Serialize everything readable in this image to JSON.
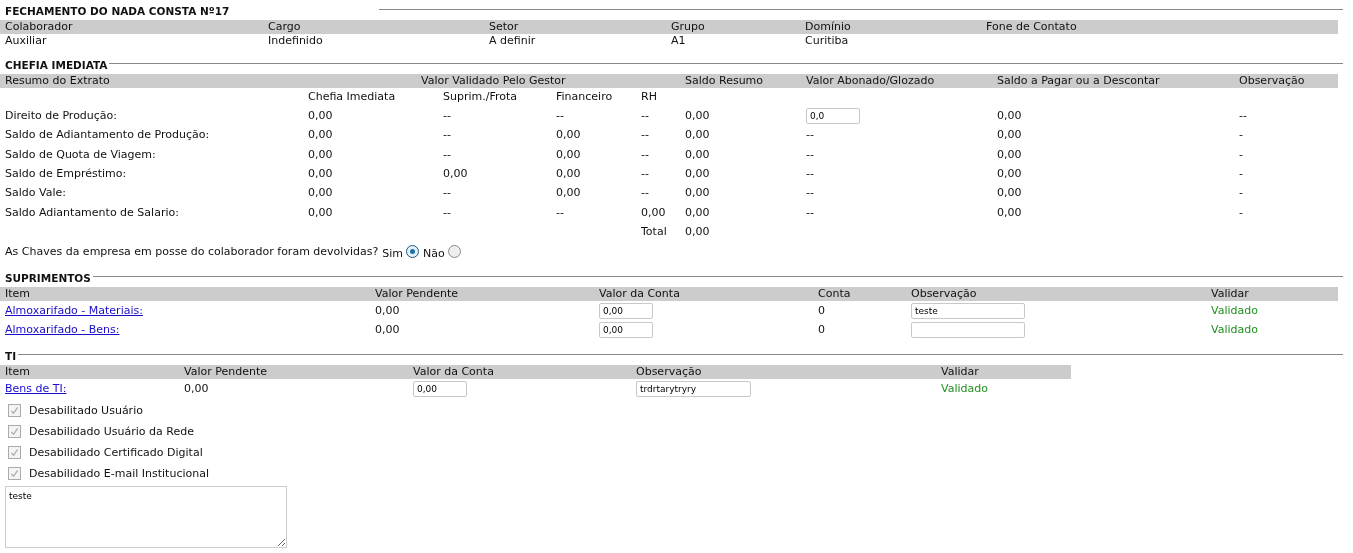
{
  "header": {
    "title": "FECHAMENTO DO NADA CONSTA Nº17",
    "columns": [
      {
        "label": "Colaborador",
        "value": "Auxiliar"
      },
      {
        "label": "Cargo",
        "value": "Indefinido"
      },
      {
        "label": "Setor",
        "value": "A definir"
      },
      {
        "label": "Grupo",
        "value": "A1"
      },
      {
        "label": "Domínio",
        "value": "Curitiba"
      },
      {
        "label": "Fone de Contato"
      }
    ]
  },
  "chefia": {
    "title": "CHEFIA IMEDIATA",
    "columns": [
      "Resumo do Extrato",
      "Valor Validado Pelo Gestor",
      "Saldo Resumo",
      "Valor Abonado/Glozado",
      "Saldo a Pagar ou a Descontar",
      "Observação"
    ],
    "subcolumns": [
      "Chefia Imediata",
      "Suprim./Frota",
      "Financeiro",
      "RH"
    ],
    "rows": [
      {
        "label": "Direito de Produção:",
        "values": [
          "0,00",
          "--",
          "--",
          "--"
        ],
        "saldo_resumo": "0,00",
        "abonado": {
          "kind": "input",
          "value": "0,0"
        },
        "saldo_pagar": "0,00",
        "observacao": "--"
      },
      {
        "label": "Saldo de Adiantamento de Produção:",
        "values": [
          "0,00",
          "--",
          "0,00",
          "--"
        ],
        "saldo_resumo": "0,00",
        "abonado": {
          "kind": "text",
          "value": "--"
        },
        "saldo_pagar": "0,00",
        "observacao": "-"
      },
      {
        "label": "Saldo de Quota de Viagem:",
        "values": [
          "0,00",
          "--",
          "0,00",
          "--"
        ],
        "saldo_resumo": "0,00",
        "abonado": {
          "kind": "text",
          "value": "--"
        },
        "saldo_pagar": "0,00",
        "observacao": "-"
      },
      {
        "label": "Saldo de Empréstimo:",
        "values": [
          "0,00",
          "0,00",
          "0,00",
          "--"
        ],
        "saldo_resumo": "0,00",
        "abonado": {
          "kind": "text",
          "value": "--"
        },
        "saldo_pagar": "0,00",
        "observacao": "-"
      },
      {
        "label": "Saldo Vale:",
        "values": [
          "0,00",
          "--",
          "0,00",
          "--"
        ],
        "saldo_resumo": "0,00",
        "abonado": {
          "kind": "text",
          "value": "--"
        },
        "saldo_pagar": "0,00",
        "observacao": "-"
      },
      {
        "label": "Saldo Adiantamento de Salario:",
        "values": [
          "0,00",
          "--",
          "--",
          "0,00"
        ],
        "saldo_resumo": "0,00",
        "abonado": {
          "kind": "text",
          "value": "--"
        },
        "saldo_pagar": "0,00",
        "observacao": "-"
      }
    ],
    "total": {
      "label": "Total",
      "value": "0,00"
    },
    "question": {
      "text": "As Chaves da empresa em posse do colaborador foram devolvidas?",
      "options": [
        {
          "label": "Sim",
          "selected": true
        },
        {
          "label": "Não",
          "selected": false
        }
      ]
    }
  },
  "suprimentos": {
    "title": "SUPRIMENTOS",
    "columns": [
      "Item",
      "Valor Pendente",
      "Valor da Conta",
      "Conta",
      "Observação",
      "Validar"
    ],
    "rows": [
      {
        "item": "Almoxarifado - Materiais:",
        "valor_pendente": "0,00",
        "valor_da_conta": "0,00",
        "conta": "0",
        "observacao": "teste",
        "status": "Validado"
      },
      {
        "item": "Almoxarifado - Bens:",
        "valor_pendente": "0,00",
        "valor_da_conta": "0,00",
        "conta": "0",
        "status": "Validado"
      }
    ]
  },
  "ti": {
    "title": "TI",
    "columns": [
      "Item",
      "Valor Pendente",
      "Valor da Conta",
      "Observação",
      "Validar"
    ],
    "rows": [
      {
        "item": "Bens de TI:",
        "valor_pendente": "0,00",
        "valor_da_conta": "0,00",
        "observacao": "trdrtarytryry",
        "status": "Validado"
      }
    ],
    "checkboxes": [
      {
        "label": "Desabilitado Usuário",
        "checked": true,
        "disabled": true
      },
      {
        "label": "Desabilidado Usuário da Rede",
        "checked": true,
        "disabled": true
      },
      {
        "label": "Desabilidado Certificado Digital",
        "checked": true,
        "disabled": true
      },
      {
        "label": "Desabilidado E-mail Institucional",
        "checked": true,
        "disabled": true
      }
    ],
    "notes": "teste"
  }
}
